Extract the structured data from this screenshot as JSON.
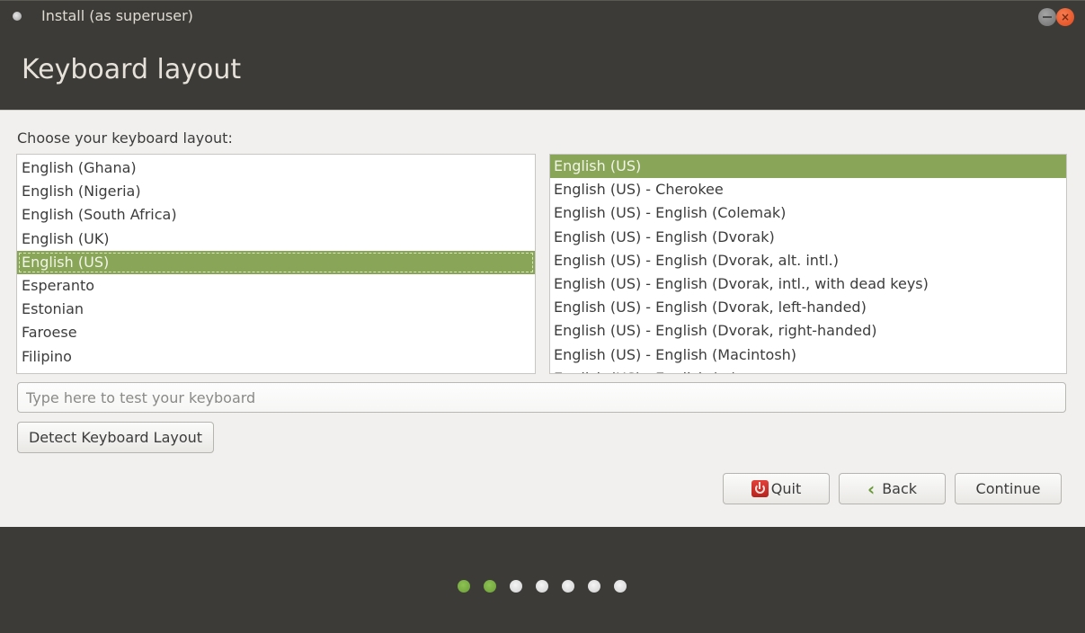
{
  "window": {
    "title": "Install (as superuser)",
    "minimize_label": "minimize",
    "close_label": "×"
  },
  "header": {
    "title": "Keyboard layout"
  },
  "main": {
    "choose_label": "Choose your keyboard layout:",
    "layouts": [
      {
        "label": "English (Ghana)",
        "selected": false
      },
      {
        "label": "English (Nigeria)",
        "selected": false
      },
      {
        "label": "English (South Africa)",
        "selected": false
      },
      {
        "label": "English (UK)",
        "selected": false
      },
      {
        "label": "English (US)",
        "selected": true
      },
      {
        "label": "Esperanto",
        "selected": false
      },
      {
        "label": "Estonian",
        "selected": false
      },
      {
        "label": "Faroese",
        "selected": false
      },
      {
        "label": "Filipino",
        "selected": false
      }
    ],
    "variants": [
      {
        "label": "English (US)",
        "selected": true
      },
      {
        "label": "English (US) - Cherokee",
        "selected": false
      },
      {
        "label": "English (US) - English (Colemak)",
        "selected": false
      },
      {
        "label": "English (US) - English (Dvorak)",
        "selected": false
      },
      {
        "label": "English (US) - English (Dvorak, alt. intl.)",
        "selected": false
      },
      {
        "label": "English (US) - English (Dvorak, intl., with dead keys)",
        "selected": false
      },
      {
        "label": "English (US) - English (Dvorak, left-handed)",
        "selected": false
      },
      {
        "label": "English (US) - English (Dvorak, right-handed)",
        "selected": false
      },
      {
        "label": "English (US) - English (Macintosh)",
        "selected": false
      },
      {
        "label": "English (US) - English (...)",
        "selected": false
      }
    ],
    "test_input": {
      "value": "",
      "placeholder": "Type here to test your keyboard"
    },
    "detect_button": "Detect Keyboard Layout"
  },
  "actions": {
    "quit": "Quit",
    "back": "Back",
    "continue": "Continue"
  },
  "progress": {
    "total_steps": 7,
    "completed_steps": 2
  },
  "colors": {
    "accent": "#88a558",
    "header_bg": "#3c3b37",
    "content_bg": "#f1f0ee",
    "close_button": "#e95420"
  }
}
